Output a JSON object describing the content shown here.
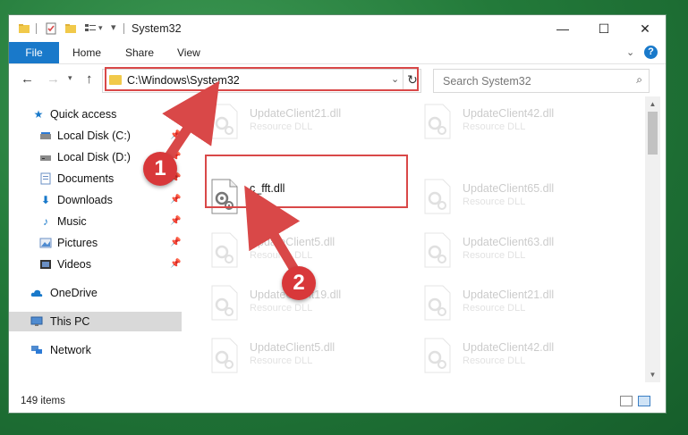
{
  "window": {
    "title": "System32",
    "controls": {
      "minimize": "—",
      "maximize": "☐",
      "close": "✕"
    }
  },
  "ribbon": {
    "tabs": [
      "File",
      "Home",
      "Share",
      "View"
    ],
    "help": "?",
    "accent": "#1979ca"
  },
  "address": {
    "path": "C:\\Windows\\System32"
  },
  "search": {
    "placeholder": "Search System32"
  },
  "sidebar": {
    "items": [
      {
        "label": "Quick access",
        "icon": "star-icon",
        "pinned": false
      },
      {
        "label": "Local Disk (C:)",
        "icon": "drive-icon",
        "pinned": true
      },
      {
        "label": "Local Disk (D:)",
        "icon": "drive-icon",
        "pinned": true
      },
      {
        "label": "Documents",
        "icon": "documents-icon",
        "pinned": true
      },
      {
        "label": "Downloads",
        "icon": "download-icon",
        "pinned": true
      },
      {
        "label": "Music",
        "icon": "music-icon",
        "pinned": true
      },
      {
        "label": "Pictures",
        "icon": "pictures-icon",
        "pinned": true
      },
      {
        "label": "Videos",
        "icon": "videos-icon",
        "pinned": true
      },
      {
        "label": "OneDrive",
        "icon": "cloud-icon",
        "pinned": false
      },
      {
        "label": "This PC",
        "icon": "computer-icon",
        "pinned": false,
        "selected": true
      },
      {
        "label": "Network",
        "icon": "network-icon",
        "pinned": false
      }
    ]
  },
  "files": {
    "highlighted": {
      "name": "c_fft.dll"
    },
    "faded": [
      {
        "name": "UpdateClient21.dll",
        "type": "Resource DLL"
      },
      {
        "name": "UpdateClient42.dll",
        "type": "Resource DLL"
      },
      {
        "name": "UpdateClient65.dll",
        "type": "Resource DLL"
      },
      {
        "name": "UpdateClient5.dll",
        "type": "Resource DLL"
      },
      {
        "name": "UpdateClient63.dll",
        "type": "Resource DLL"
      },
      {
        "name": "UpdateClient19.dll",
        "type": "Resource DLL"
      },
      {
        "name": "UpdateClient21.dll",
        "type": "Resource DLL"
      },
      {
        "name": "UpdateClient5.dll",
        "type": "Resource DLL"
      },
      {
        "name": "UpdateClient42.dll",
        "type": "Resource DLL"
      }
    ]
  },
  "status": {
    "item_count": "149 items"
  },
  "annotations": {
    "badge1": "1",
    "badge2": "2",
    "color": "#d94848"
  }
}
